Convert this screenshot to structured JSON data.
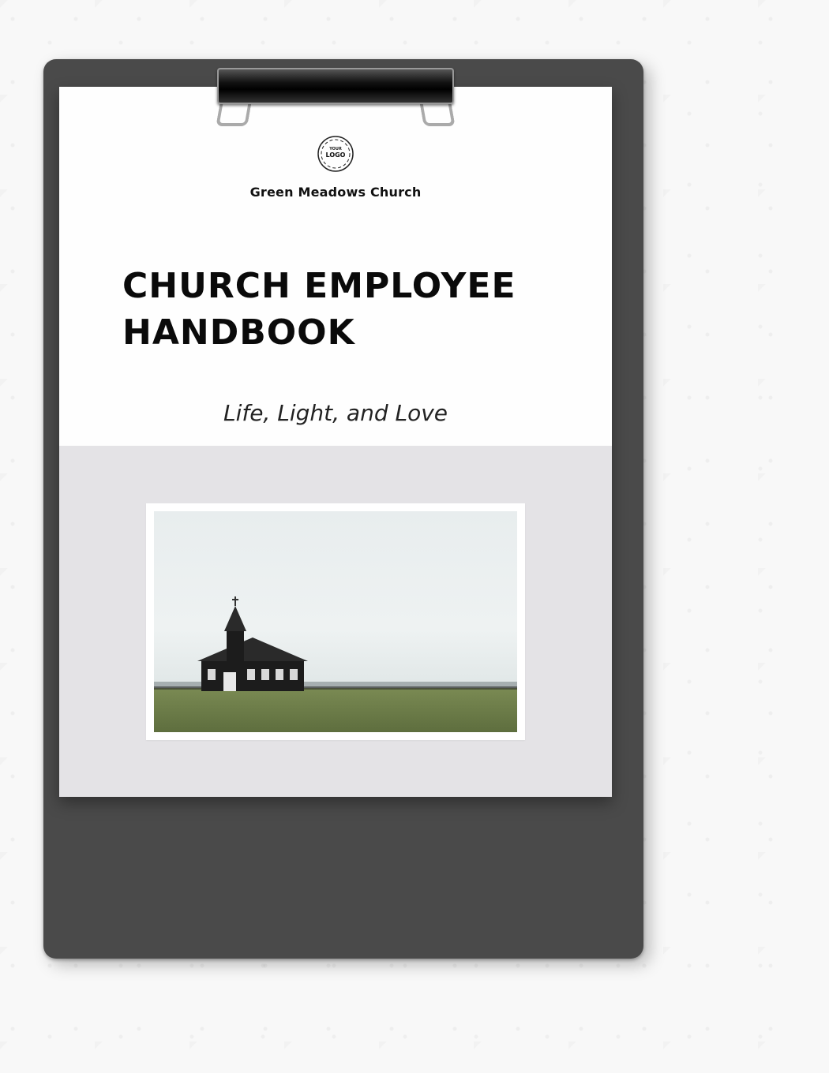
{
  "logo": {
    "placeholder_top": "YOUR",
    "placeholder_main": "LOGO"
  },
  "organization": "Green Meadows Church",
  "title_line1": "CHURCH EMPLOYEE",
  "title_line2": "HANDBOOK",
  "tagline": "Life, Light, and Love",
  "image_alt": "church-photo"
}
